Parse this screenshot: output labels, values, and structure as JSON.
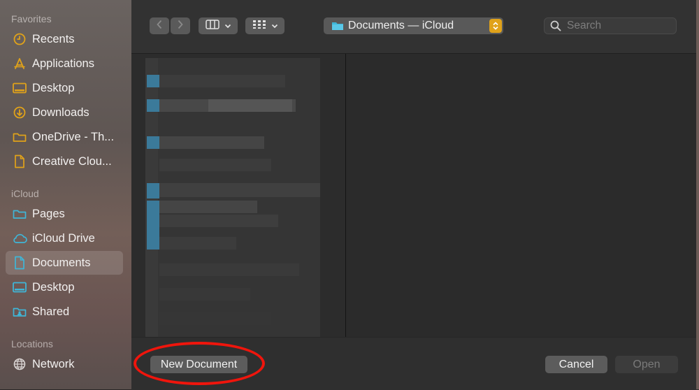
{
  "sidebar": {
    "sections": [
      {
        "title": "Favorites",
        "items": [
          {
            "label": "Recents",
            "icon": "clock-icon"
          },
          {
            "label": "Applications",
            "icon": "applications-icon"
          },
          {
            "label": "Desktop",
            "icon": "desktop-icon"
          },
          {
            "label": "Downloads",
            "icon": "downloads-icon"
          },
          {
            "label": "OneDrive - Th...",
            "icon": "folder-icon"
          },
          {
            "label": "Creative Clou...",
            "icon": "document-icon"
          }
        ]
      },
      {
        "title": "iCloud",
        "items": [
          {
            "label": "Pages",
            "icon": "folder-icon"
          },
          {
            "label": "iCloud Drive",
            "icon": "cloud-icon"
          },
          {
            "label": "Documents",
            "icon": "document-icon",
            "selected": true
          },
          {
            "label": "Desktop",
            "icon": "desktop-icon"
          },
          {
            "label": "Shared",
            "icon": "shared-folder-icon"
          }
        ]
      },
      {
        "title": "Locations",
        "items": [
          {
            "label": "Network",
            "icon": "globe-icon"
          }
        ]
      }
    ]
  },
  "toolbar": {
    "location": "Documents — iCloud",
    "search_placeholder": "Search"
  },
  "footer": {
    "new_document": "New Document",
    "cancel": "Cancel",
    "open": "Open"
  },
  "colors": {
    "accent_yellow": "#e0a21a",
    "icloud_icon_blue": "#3fb6d8",
    "annotation_red": "#f0150c"
  }
}
